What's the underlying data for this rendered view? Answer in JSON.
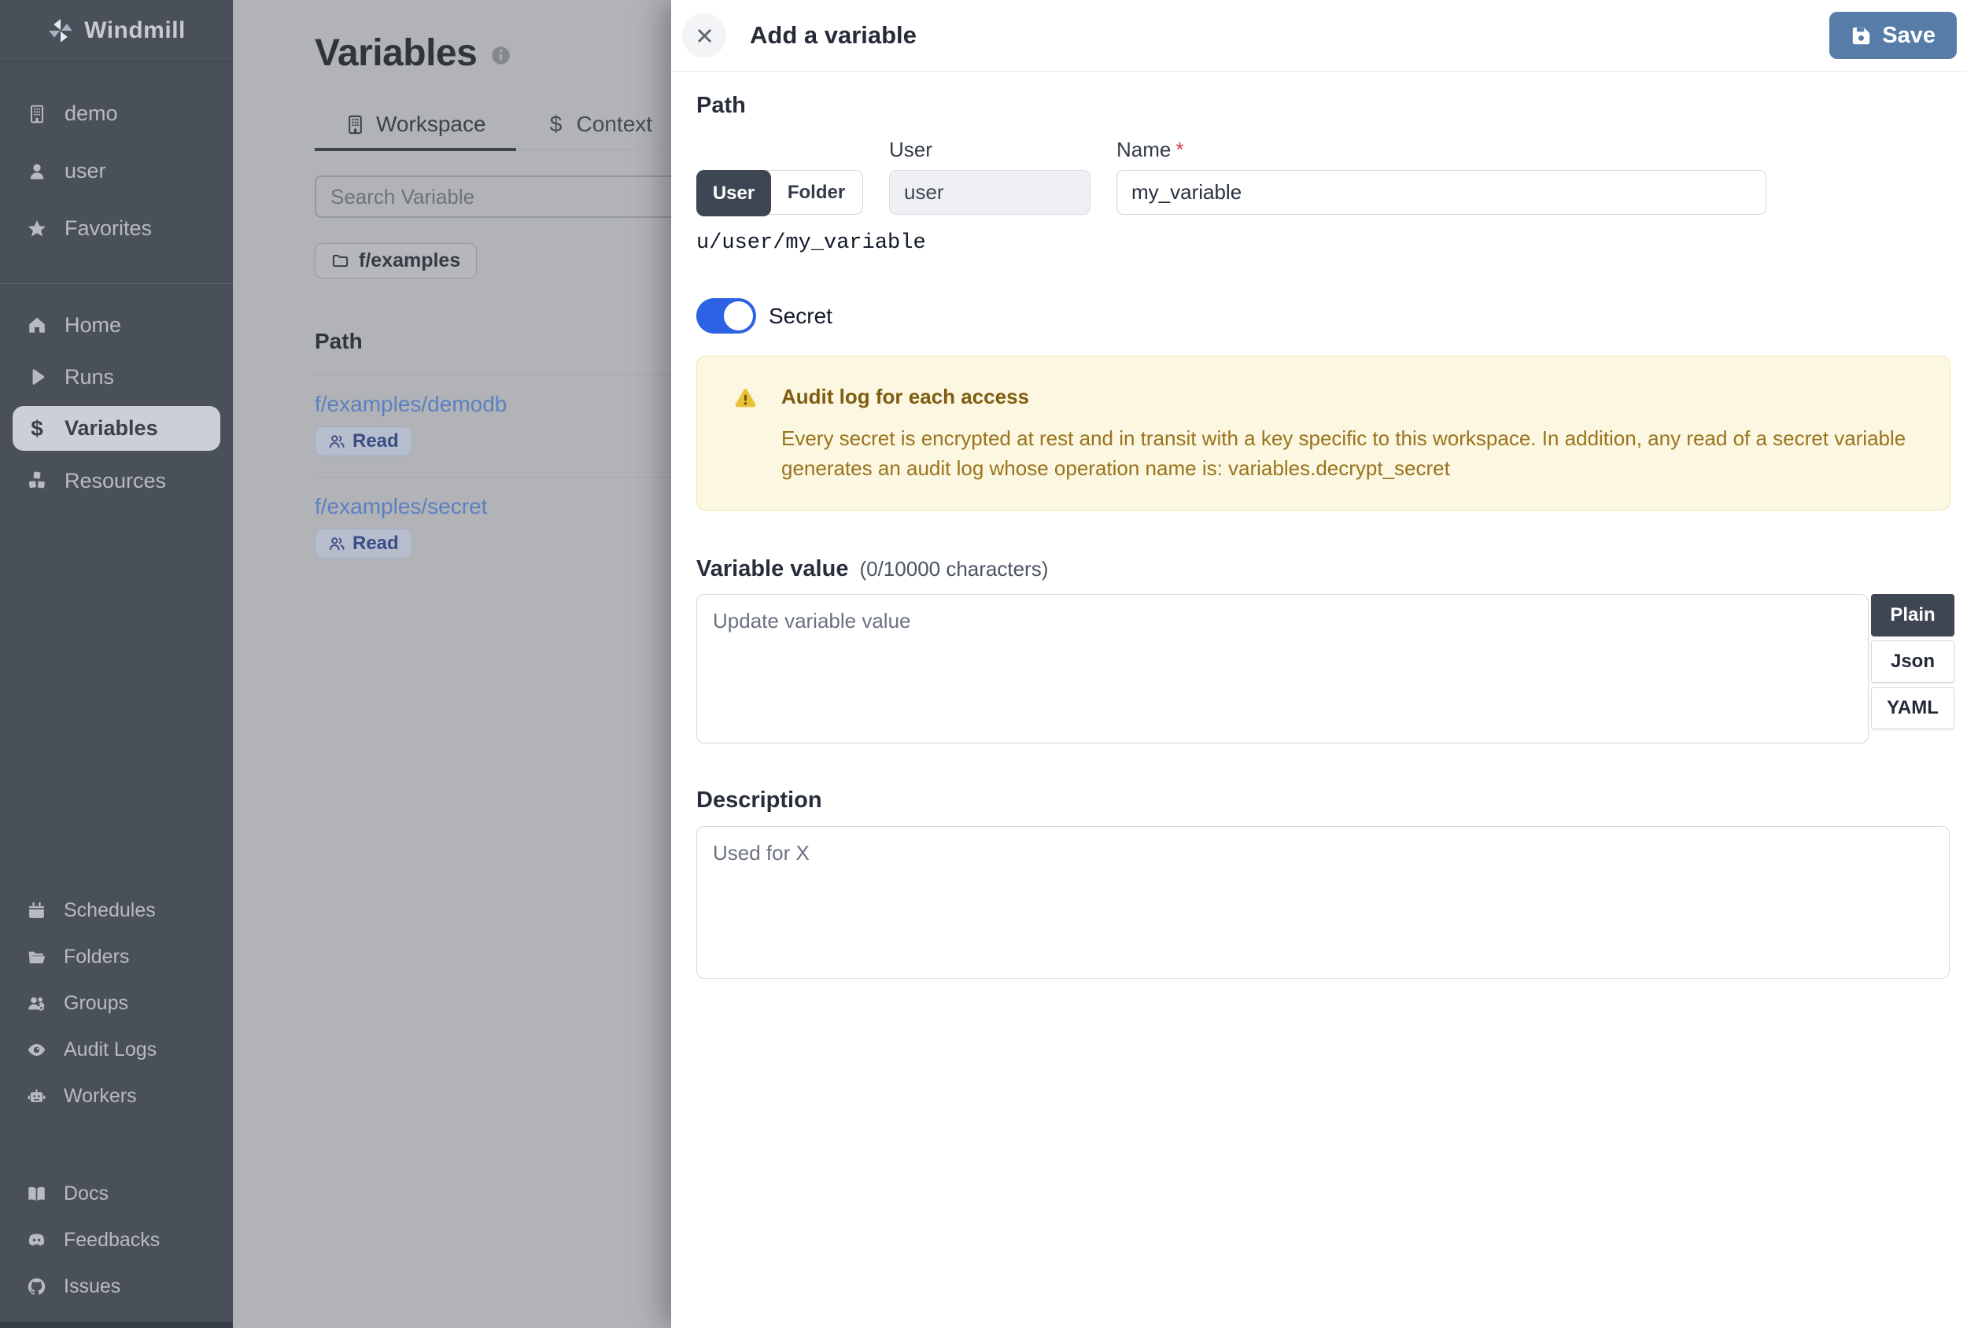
{
  "colors": {
    "save_blue": "#587ca8",
    "toggle_blue": "#2b63e4",
    "link_blue": "#5c80c2",
    "active_segment": "#3e4653",
    "warning_bg": "#fbf7e1",
    "warning_border": "#eee8b4",
    "warning_title": "#7f5d10",
    "warning_text": "#9a731d",
    "required_red": "#d23b3b"
  },
  "sidebar": {
    "brand": "Windmill",
    "workspace": {
      "label": "demo"
    },
    "account": {
      "label": "user"
    },
    "favorites": {
      "label": "Favorites"
    },
    "nav": [
      {
        "label": "Home"
      },
      {
        "label": "Runs"
      },
      {
        "label": "Variables",
        "active": true
      },
      {
        "label": "Resources"
      }
    ],
    "admin_nav": [
      {
        "label": "Schedules"
      },
      {
        "label": "Folders"
      },
      {
        "label": "Groups"
      },
      {
        "label": "Audit Logs"
      },
      {
        "label": "Workers"
      }
    ],
    "footer_nav": [
      {
        "label": "Docs"
      },
      {
        "label": "Feedbacks"
      },
      {
        "label": "Issues"
      }
    ]
  },
  "page": {
    "title": "Variables",
    "tabs": [
      {
        "label": "Workspace",
        "active": true
      },
      {
        "label": "Context"
      }
    ],
    "search_placeholder": "Search Variable",
    "folder_chip": "f/examples",
    "table": {
      "path_header": "Path",
      "rows": [
        {
          "path": "f/examples/demodb",
          "badge": "Read"
        },
        {
          "path": "f/examples/secret",
          "badge": "Read"
        }
      ]
    }
  },
  "drawer": {
    "title": "Add a variable",
    "save": "Save",
    "path": {
      "heading": "Path",
      "segments": {
        "user": "User",
        "folder": "Folder"
      },
      "owner_label": "User",
      "owner_value": "user",
      "name_label": "Name",
      "required": "*",
      "name_value": "my_variable",
      "full_path": "u/user/my_variable"
    },
    "secret": {
      "label": "Secret",
      "on": true
    },
    "warning": {
      "title": "Audit log for each access",
      "body": "Every secret is encrypted at rest and in transit with a key specific to this workspace. In addition, any read of a secret variable generates an audit log whose operation name is: variables.decrypt_secret"
    },
    "value": {
      "heading": "Variable value",
      "counter": "(0/10000 characters)",
      "placeholder": "Update variable value",
      "formats": [
        {
          "label": "Plain",
          "active": true
        },
        {
          "label": "Json"
        },
        {
          "label": "YAML"
        }
      ]
    },
    "description": {
      "heading": "Description",
      "placeholder": "Used for X"
    }
  }
}
